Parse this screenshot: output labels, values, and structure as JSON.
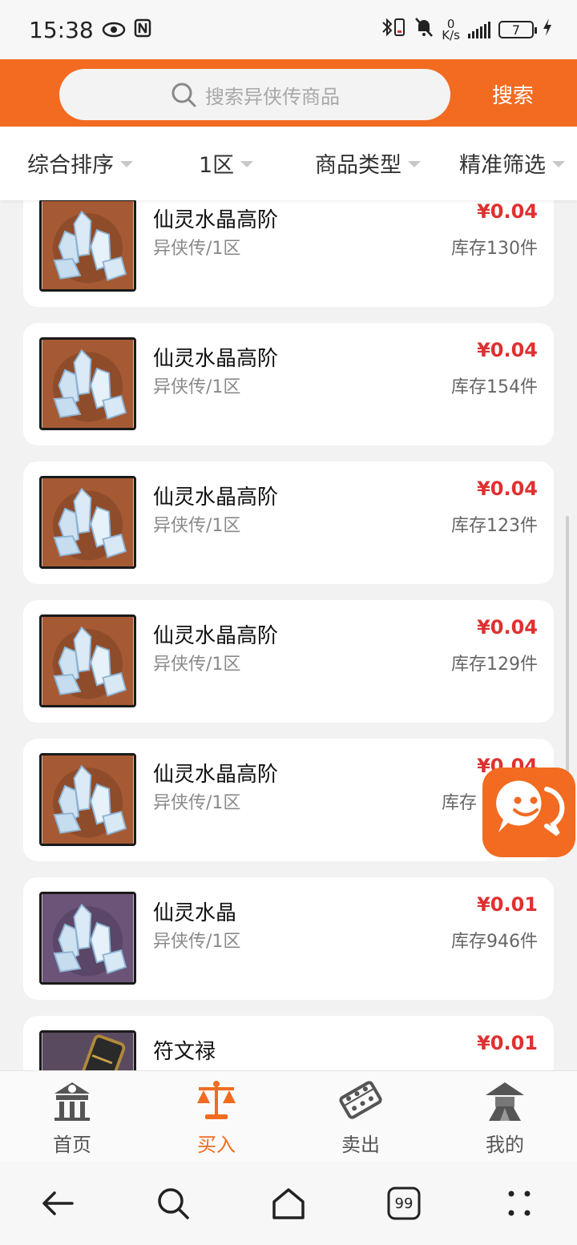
{
  "status_bar": {
    "time": "15:38",
    "net_speed_value": "0",
    "net_speed_unit": "K/s",
    "battery": "7"
  },
  "search": {
    "placeholder": "搜索异侠传商品",
    "button_label": "搜索"
  },
  "filters": [
    {
      "label": "综合排序"
    },
    {
      "label": "1区"
    },
    {
      "label": "商品类型"
    },
    {
      "label": "精准筛选"
    }
  ],
  "items": [
    {
      "title": "仙灵水晶高阶",
      "subtitle": "异侠传/1区",
      "price": "¥0.04",
      "stock": "库存130件",
      "thumb_color": "#a55a34"
    },
    {
      "title": "仙灵水晶高阶",
      "subtitle": "异侠传/1区",
      "price": "¥0.04",
      "stock": "库存154件",
      "thumb_color": "#a55a34"
    },
    {
      "title": "仙灵水晶高阶",
      "subtitle": "异侠传/1区",
      "price": "¥0.04",
      "stock": "库存123件",
      "thumb_color": "#a55a34"
    },
    {
      "title": "仙灵水晶高阶",
      "subtitle": "异侠传/1区",
      "price": "¥0.04",
      "stock": "库存129件",
      "thumb_color": "#a55a34"
    },
    {
      "title": "仙灵水晶高阶",
      "subtitle": "异侠传/1区",
      "price": "¥0.04",
      "stock": "库存",
      "thumb_color": "#a55a34"
    },
    {
      "title": "仙灵水晶",
      "subtitle": "异侠传/1区",
      "price": "¥0.01",
      "stock": "库存946件",
      "thumb_color": "#6b5478"
    },
    {
      "title": "符文禄",
      "subtitle": "",
      "price": "¥0.01",
      "stock": "",
      "thumb_color": "#5a4a60"
    }
  ],
  "tabs": [
    {
      "label": "首页",
      "icon": "home-pavilion-icon"
    },
    {
      "label": "买入",
      "icon": "scale-icon"
    },
    {
      "label": "卖出",
      "icon": "abacus-icon"
    },
    {
      "label": "我的",
      "icon": "profile-hat-icon"
    }
  ],
  "system_nav": {
    "tabs_count": "99"
  },
  "colors": {
    "brand": "#f26b21",
    "price": "#e03030"
  }
}
